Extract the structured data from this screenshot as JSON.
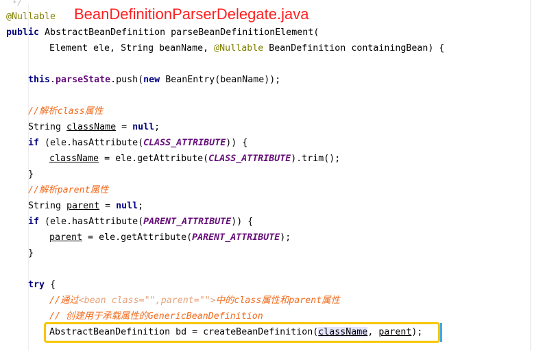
{
  "title": "BeanDefinitionParserDelegate.java",
  "lines": {
    "top": "*/",
    "l1": {
      "ann": "@Nullable"
    },
    "l2": {
      "kw": "public",
      "text": " AbstractBeanDefinition parseBeanDefinitionElement("
    },
    "l3": {
      "a": "Element ele, String beanName, ",
      "ann": "@Nullable",
      "b": " BeanDefinition containingBean) {"
    },
    "l4": {
      "kw1": "this",
      "dot": ".",
      "fld": "parseState",
      "a": ".push(",
      "kw2": "new",
      "b": " BeanEntry(beanName));"
    },
    "l5": {
      "cmt": "//解析class属性"
    },
    "l6": {
      "a": "String ",
      "var": "className",
      "b": " = ",
      "kw": "null",
      "c": ";"
    },
    "l7": {
      "kw": "if",
      "a": " (ele.hasAttribute(",
      "cnst": "CLASS_ATTRIBUTE",
      "b": ")) {"
    },
    "l8": {
      "var": "className",
      "a": " = ele.getAttribute(",
      "cnst": "CLASS_ATTRIBUTE",
      "b": ").trim();"
    },
    "l9": {
      "a": "}"
    },
    "l10": {
      "cmt": "//解析parent属性"
    },
    "l11": {
      "a": "String ",
      "var": "parent",
      "b": " = ",
      "kw": "null",
      "c": ";"
    },
    "l12": {
      "kw": "if",
      "a": " (ele.hasAttribute(",
      "cnst": "PARENT_ATTRIBUTE",
      "b": ")) {"
    },
    "l13": {
      "var": "parent",
      "a": " = ele.getAttribute(",
      "cnst": "PARENT_ATTRIBUTE",
      "b": ");"
    },
    "l14": {
      "a": "}"
    },
    "l15": {
      "kw": "try",
      "a": " {"
    },
    "l16": {
      "c1": "//通过",
      "c2": "<bean class=\"\",parent=\"\">",
      "c3": "中的class属性和parent属性"
    },
    "l17": {
      "cmt": "// 创建用于承载属性的GenericBeanDefinition"
    },
    "l18": {
      "a": "AbstractBeanDefinition bd = createBeanDefinition(",
      "v1": "className",
      "b": ", ",
      "v2": "parent",
      "c": ");"
    }
  },
  "colors": {
    "keyword": "#000080",
    "annotation": "#808000",
    "field": "#660e7a",
    "comment": "#f26b1d",
    "title": "#ff2020",
    "highlight_border": "#f7c600",
    "caret_marker": "#3faae8"
  }
}
